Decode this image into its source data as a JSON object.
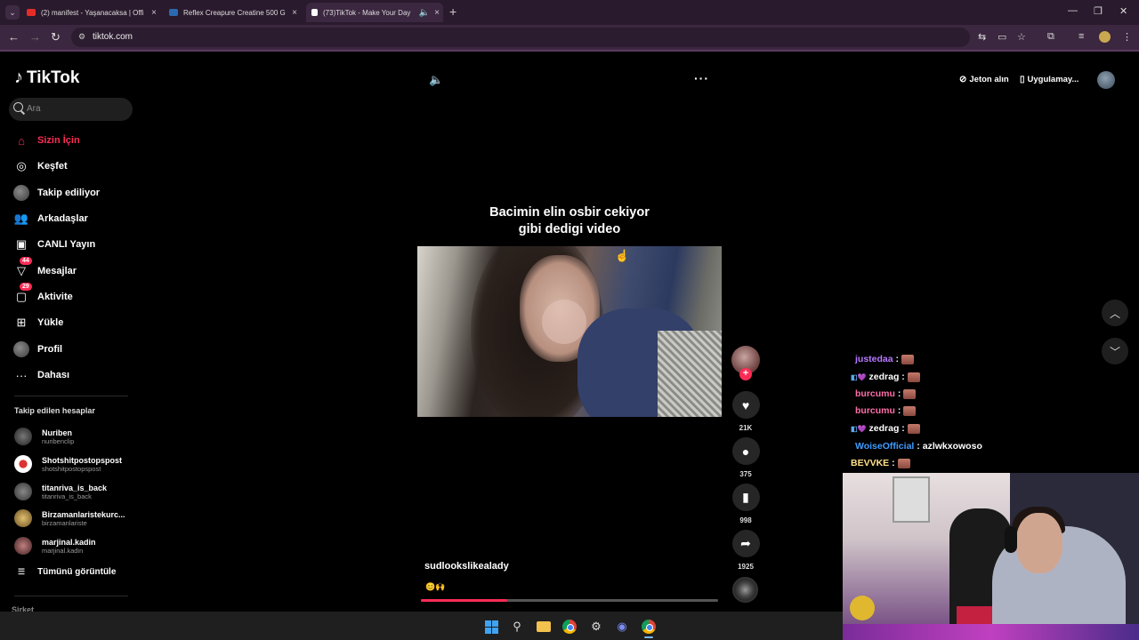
{
  "browser": {
    "tabs": [
      {
        "title": "(2) manifest - Yaşanacaksa | Offi",
        "color": "#e52d27"
      },
      {
        "title": "Reflex Creapure Creatine 500 G",
        "color": "#2a6ab0"
      },
      {
        "title": "(73)TikTok - Make Your Day",
        "color": "#ffffff"
      }
    ],
    "url": "tiktok.com"
  },
  "sidebar": {
    "logo": "TikTok",
    "search_placeholder": "Ara",
    "nav": [
      {
        "label": "Sizin İçin",
        "icon": "home-icon"
      },
      {
        "label": "Keşfet",
        "icon": "compass-icon"
      },
      {
        "label": "Takip ediliyor",
        "icon": "following-avatar-icon"
      },
      {
        "label": "Arkadaşlar",
        "icon": "friends-icon"
      },
      {
        "label": "CANLI Yayın",
        "icon": "live-icon"
      },
      {
        "label": "Mesajlar",
        "icon": "messages-icon",
        "badge": "44"
      },
      {
        "label": "Aktivite",
        "icon": "activity-icon",
        "badge": "29"
      },
      {
        "label": "Yükle",
        "icon": "upload-icon"
      },
      {
        "label": "Profil",
        "icon": "profile-avatar-icon"
      },
      {
        "label": "Dahası",
        "icon": "more-dots-icon"
      }
    ],
    "following_header": "Takip edilen hesaplar",
    "following": [
      {
        "name": "Nuriben",
        "handle": "nuribenclip"
      },
      {
        "name": "Shotshitpostopspost",
        "handle": "shotshitpostopspost"
      },
      {
        "name": "titanriva_is_back",
        "handle": "titanriva_is_back"
      },
      {
        "name": "Birzamanlaristekurc...",
        "handle": "birzamanlariste"
      },
      {
        "name": "marjinal.kadin",
        "handle": "marjinal.kadin"
      }
    ],
    "see_all": "Tümünü görüntüle",
    "company": "Şirket"
  },
  "video": {
    "caption_line1": "Bacimin elin osbir cekiyor",
    "caption_line2": "gibi dedigi video",
    "author": "sudlookslikealady",
    "description": "😊🙌",
    "progress_fraction": 0.29
  },
  "actions": {
    "likes": "21K",
    "comments": "375",
    "saves": "998",
    "shares": "1925"
  },
  "header_right": {
    "coins": "Jeton alın",
    "get_app": "Uygulamay..."
  },
  "chat": [
    {
      "user": "justedaa",
      "color": "#b77aff",
      "msg": ""
    },
    {
      "user": "zedrag",
      "color": "#ffffff",
      "msg": "",
      "badges": "◧💜"
    },
    {
      "user": "burcumu",
      "color": "#ff6fa8",
      "msg": ""
    },
    {
      "user": "burcumu",
      "color": "#ff6fa8",
      "msg": ""
    },
    {
      "user": "zedrag",
      "color": "#ffffff",
      "msg": "",
      "badges": "◧💜"
    },
    {
      "user": "WoiseOfficial",
      "color": "#3d9cff",
      "msg": "azlwkxowoso"
    },
    {
      "user": "BEVVKE",
      "color": "#ffe08a",
      "msg": ""
    }
  ]
}
